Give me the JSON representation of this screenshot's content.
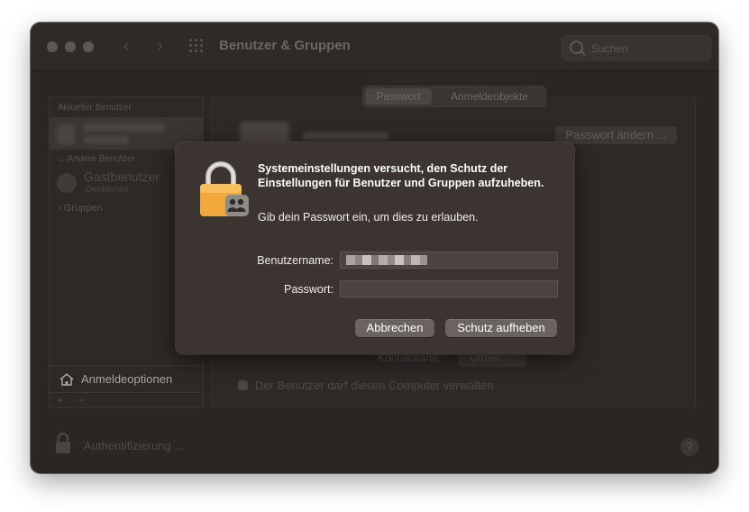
{
  "window": {
    "title": "Benutzer & Gruppen",
    "search_placeholder": "Suchen",
    "back_glyph": "‹",
    "forward_glyph": "›"
  },
  "sidebar": {
    "current_user_header": "Aktueller Benutzer",
    "other_users_header": "Andere Benutzer",
    "guest_name": "Gastbenutzer",
    "guest_status": "Deaktiviert",
    "groups_label": "Gruppen",
    "login_options": "Anmeldeoptionen",
    "plus": "+",
    "minus": "−"
  },
  "tabs": [
    "Passwort",
    "Anmeldeobjekte"
  ],
  "main": {
    "change_password_button": "Passwort ändern ...",
    "contact_card_label": "Kontaktkarte:",
    "open_button": "Öffnen ...",
    "admin_checkbox_label": "Der Benutzer darf diesen Computer verwalten"
  },
  "footer": {
    "auth_text": "Authentifizierung ...",
    "help_glyph": "?"
  },
  "dialog": {
    "title": "Systemeinstellungen versucht, den Schutz der Einstellungen für Benutzer und Gruppen aufzuheben.",
    "message": "Gib dein Passwort ein, um dies zu erlauben.",
    "username_label": "Benutzername:",
    "username_value_redacted": true,
    "password_label": "Passwort:",
    "password_value": "",
    "cancel_button": "Abbrechen",
    "confirm_button": "Schutz aufheben"
  },
  "colors": {
    "window_bg": "#2b2624",
    "dialog_bg": "#3b3431",
    "lock_gold": "#f0a93a",
    "button_bg": "#6b6360"
  },
  "icons": [
    "search-icon",
    "grid-icon",
    "lock-icon",
    "users-badge-icon",
    "house-icon",
    "chevron-right-icon",
    "chevron-down-icon",
    "help-icon"
  ]
}
